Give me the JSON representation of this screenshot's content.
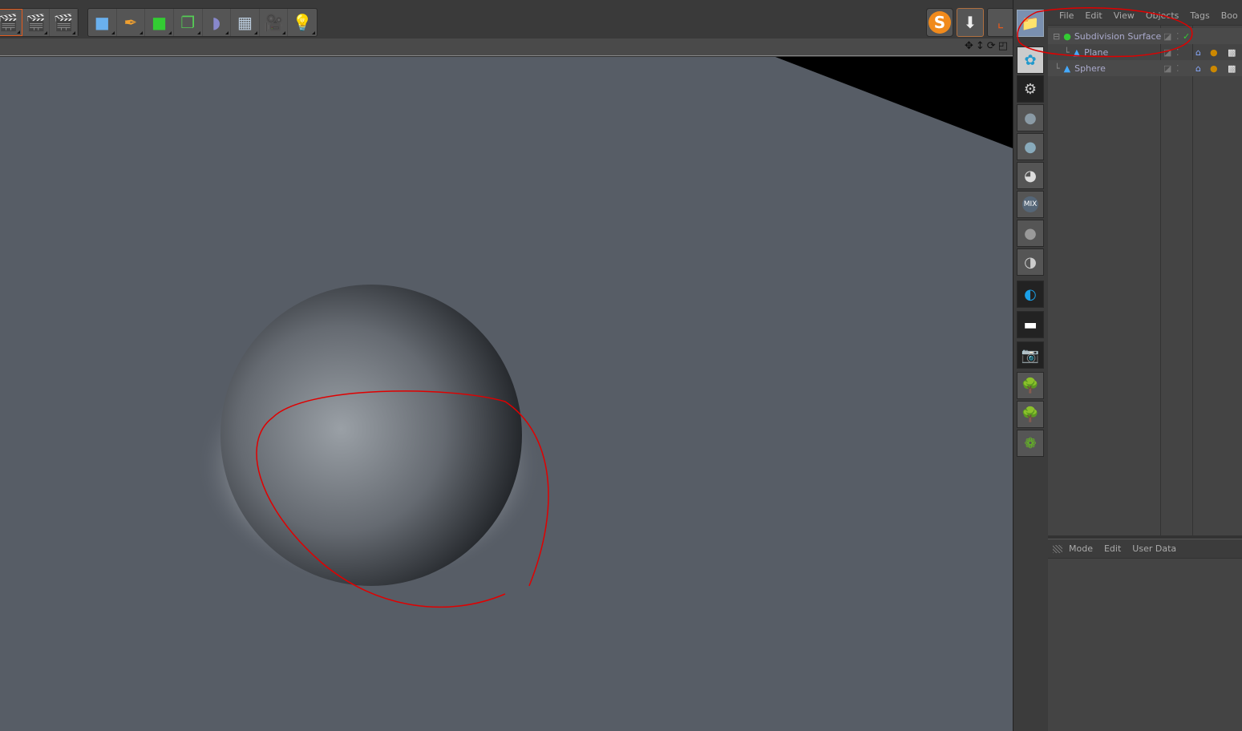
{
  "toolbar": {
    "render_group": [
      {
        "icon": "render-view-icon"
      },
      {
        "icon": "render-to-picture-viewer-icon"
      },
      {
        "icon": "render-settings-icon"
      }
    ],
    "object_group": [
      {
        "icon": "cube-icon"
      },
      {
        "icon": "pen-spline-icon"
      },
      {
        "icon": "subdivision-surface-icon"
      },
      {
        "icon": "cloner-icon"
      },
      {
        "icon": "deformer-bend-icon"
      },
      {
        "icon": "floor-scene-icon"
      },
      {
        "icon": "camera-icon"
      },
      {
        "icon": "light-icon"
      }
    ],
    "right_buttons": [
      {
        "icon": "s-plugin-icon",
        "label": "S"
      },
      {
        "icon": "drop-to-floor-icon"
      },
      {
        "icon": "coordinate-axis-icon"
      },
      {
        "icon": "folder-layout-icon"
      }
    ]
  },
  "viewport": {
    "nav_icons": [
      "move-icon",
      "zoom-icon",
      "rotate-icon",
      "maximize-icon"
    ]
  },
  "palette": [
    "render-plugin-icon",
    "settings-gear-icon",
    "material-icon",
    "glass-material-icon",
    "checker-material-icon",
    "mix-material-icon",
    "metal-material-icon",
    "reflect-material-icon",
    "contrast-icon",
    "area-light-icon",
    "camera-red-icon",
    "tree-icon",
    "tree2-icon",
    "ivy-icon"
  ],
  "object_manager": {
    "menu": [
      "File",
      "Edit",
      "View",
      "Objects",
      "Tags",
      "Boo"
    ],
    "objects": [
      {
        "name": "Subdivision Surface",
        "level": 0,
        "icon": "subdivision-surface-icon",
        "enabled": true
      },
      {
        "name": "Plane",
        "level": 1,
        "icon": "plane-icon",
        "tags": [
          "phong-icon",
          "material-icon",
          "checker-tag-icon"
        ]
      },
      {
        "name": "Sphere",
        "level": 0,
        "icon": "sphere-icon",
        "tags": [
          "phong-icon",
          "material-icon",
          "checker-tag-icon"
        ]
      }
    ]
  },
  "attribute_manager": {
    "menu": [
      "Mode",
      "Edit",
      "User Data"
    ]
  },
  "colors": {
    "annotation": "#e00000",
    "viewport_bg": "#575d66",
    "accent": "#f08a1c"
  }
}
